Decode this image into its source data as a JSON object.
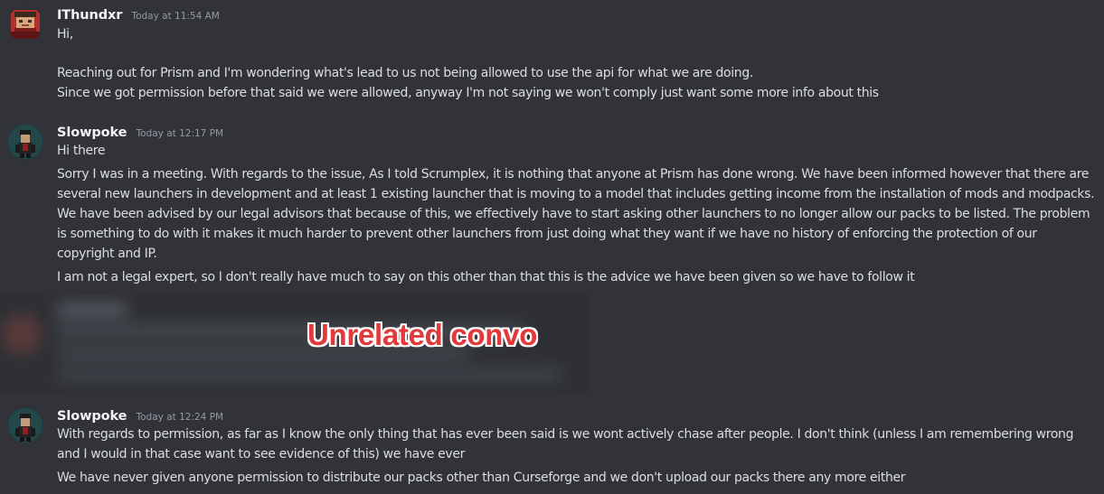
{
  "messages": [
    {
      "username": "IThundxr",
      "timestamp": "Today at 11:54 AM",
      "avatar_icon": "pixel-avatar-red-icon",
      "lines": [
        "Hi,",
        "",
        "Reaching out for Prism and I'm wondering what's lead to us not being allowed to use the api for what we are doing.",
        "Since we got permission before that said we were allowed, anyway I'm not saying we won't comply just want some more info about this"
      ]
    },
    {
      "username": "Slowpoke",
      "timestamp": "Today at 12:17 PM",
      "avatar_icon": "character-avatar-dark-icon",
      "lines": [
        "Hi there",
        "Sorry I was in a meeting.  With regards to the issue, As I told Scrumplex, it is nothing that anyone at Prism has done wrong. We have been informed however that there are",
        "several new launchers in development and at least 1 existing launcher that is moving to a model that includes getting income from the installation of mods and modpacks.",
        "We have been advised by our legal advisors that because of this, we effectively have to start asking other launchers to no longer allow our packs to be listed. The problem",
        "is something to do with it makes it much harder to prevent other launchers from just doing what they want if we have no history of enforcing the protection of our",
        "copyright and IP.",
        "I am not a legal expert, so I don't really have much to say on this other than that this is the advice we have been given so we have to follow it"
      ]
    },
    {
      "username": "Slowpoke",
      "timestamp": "Today at 12:24 PM",
      "avatar_icon": "character-avatar-dark-icon",
      "lines": [
        "With regards to permission, as far as I know the only thing that has ever been said is we wont actively chase after people. I don't think (unless I am remembering wrong",
        "and I would in that case want to see evidence of this) we have ever",
        "We have never given anyone permission to distribute our packs other than Curseforge and we don't upload our packs there any more either"
      ]
    }
  ],
  "overlay": {
    "label": "Unrelated convo"
  },
  "colors": {
    "background": "#313338",
    "text": "#dbdee1",
    "username": "#f2f3f5",
    "timestamp": "#949ba4",
    "overlay_text": "#e23a3a",
    "overlay_outline": "#ffffff"
  }
}
